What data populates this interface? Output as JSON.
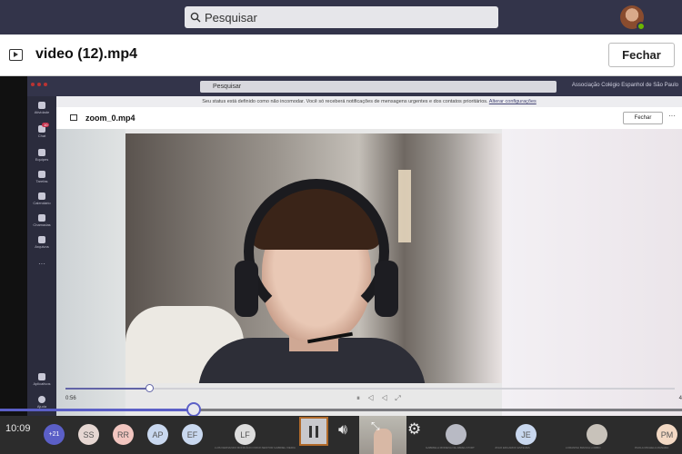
{
  "search": {
    "placeholder": "Pesquisar"
  },
  "header": {
    "title": "video (12).mp4",
    "close_label": "Fechar"
  },
  "inner": {
    "search_text": "Pesquisar",
    "org": "Associação Colégio Espanhol de São Paulo",
    "notice": "Seu status está definido como não incomodar. Você só receberá notificações de mensagens urgentes e dos contatos prioritários.",
    "notice_link": "Alterar configurações",
    "title": "zoom_0.mp4",
    "close_label": "Fechar",
    "more": "···",
    "time_current": "0:56",
    "time_total": "4",
    "rail": [
      {
        "label": "Atividade",
        "icon": "bell-icon"
      },
      {
        "label": "Chat",
        "icon": "chat-icon",
        "badge": "10"
      },
      {
        "label": "Equipes",
        "icon": "teams-icon"
      },
      {
        "label": "Tarefas",
        "icon": "assignments-icon"
      },
      {
        "label": "Calendário",
        "icon": "calendar-icon"
      },
      {
        "label": "Chamadas",
        "icon": "phone-icon"
      },
      {
        "label": "Arquivos",
        "icon": "files-icon"
      },
      {
        "label": "···",
        "icon": "more-icon"
      },
      {
        "label": "Aplicativos",
        "icon": "apps-icon"
      },
      {
        "label": "Ajuda",
        "icon": "help-icon"
      }
    ],
    "progress": 0.14
  },
  "player": {
    "elapsed": "10:09",
    "progress": 0.284
  },
  "participants": [
    {
      "initials": "+21",
      "color": "#5b5fc7"
    },
    {
      "initials": "SS",
      "color": "#e6d7d2"
    },
    {
      "initials": "RR",
      "color": "#f2c6c0"
    },
    {
      "initials": "AP",
      "color": "#c9d8ef"
    },
    {
      "initials": "EF",
      "color": "#c9d8ef"
    },
    {
      "initials": "LF",
      "color": "#dddddd",
      "name": "LUIS FERNANDO BONIFÁCIO FRICK"
    },
    {
      "initials": "JE",
      "color": "#c9d8ef",
      "name": "JOAO EDUARDO ESTEVES"
    },
    {
      "initials": "PM",
      "color": "#f3d9c4",
      "name": "PAOLA MICHELA MANARA"
    }
  ],
  "other_names": [
    "NESTOR GABRIEL VIEIRA",
    "GABRIELA MORENA DE ABREU PORT",
    "LORANISA BIANCA LOMBO"
  ],
  "colors": {
    "accent": "#5b5fc7",
    "topbar": "#33344a"
  }
}
